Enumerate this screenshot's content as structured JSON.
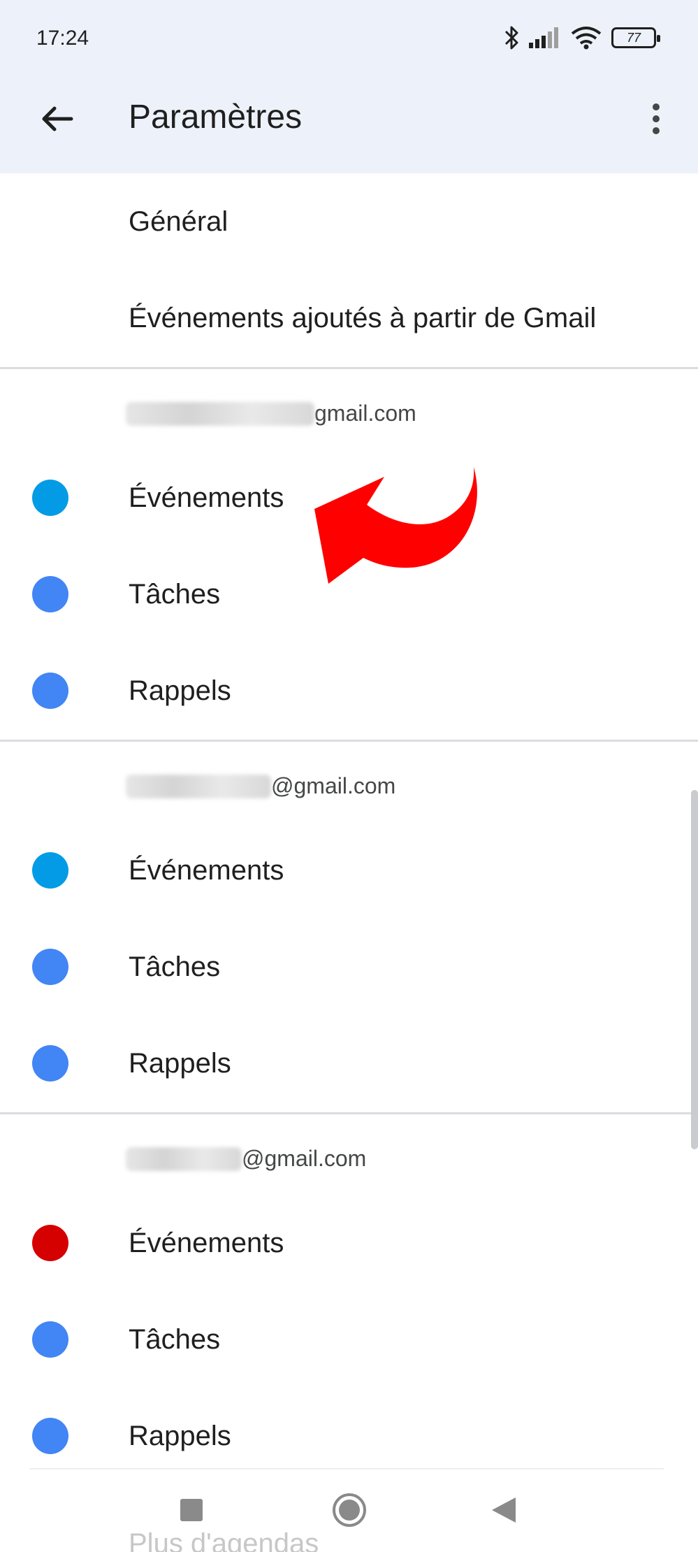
{
  "status_bar": {
    "time": "17:24",
    "battery": "77"
  },
  "app_bar": {
    "title": "Paramètres"
  },
  "general_items": [
    {
      "label": "Général"
    },
    {
      "label": "Événements ajoutés à partir de Gmail"
    }
  ],
  "accounts": [
    {
      "email_suffix": "gmail.com",
      "calendars": [
        {
          "label": "Événements",
          "color": "#039be5"
        },
        {
          "label": "Tâches",
          "color": "#4285f4"
        },
        {
          "label": "Rappels",
          "color": "#4285f4"
        }
      ]
    },
    {
      "email_suffix": "@gmail.com",
      "calendars": [
        {
          "label": "Événements",
          "color": "#039be5"
        },
        {
          "label": "Tâches",
          "color": "#4285f4"
        },
        {
          "label": "Rappels",
          "color": "#4285f4"
        }
      ]
    },
    {
      "email_suffix": "@gmail.com",
      "calendars": [
        {
          "label": "Événements",
          "color": "#d50000"
        },
        {
          "label": "Tâches",
          "color": "#4285f4"
        },
        {
          "label": "Rappels",
          "color": "#4285f4"
        }
      ]
    }
  ],
  "footer_partial": "Plus d'agendas",
  "colors": {
    "annotation_arrow": "#ff0000",
    "appbar_bg": "#edf2fa"
  }
}
